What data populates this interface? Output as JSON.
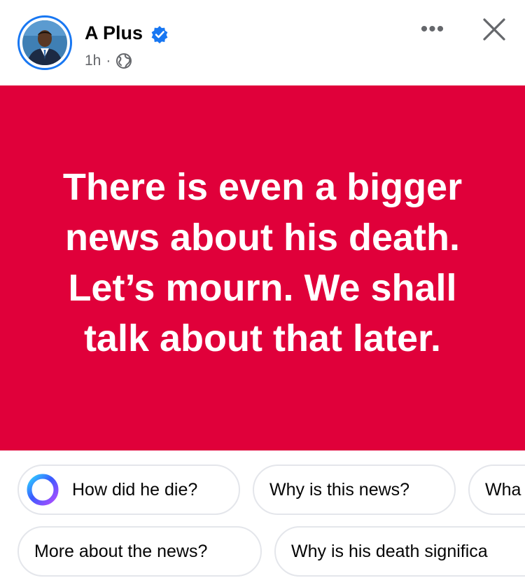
{
  "post": {
    "author_name": "A Plus",
    "verified": true,
    "timestamp": "1h",
    "meta_separator": "·",
    "audience_icon": "globe-icon",
    "more_label": "•••",
    "text": "There is even a bigger news about his death. Let’s mourn. We shall talk about that later.",
    "background_color": "#e0003a"
  },
  "suggestions": {
    "row1": [
      {
        "label": "How did he die?",
        "icon": "meta-ai-icon"
      },
      {
        "label": "Why is this news?"
      },
      {
        "label": "Wha"
      }
    ],
    "row2": [
      {
        "label": "More about the news?"
      },
      {
        "label": "Why is his death significa"
      }
    ]
  },
  "colors": {
    "accent": "#1877f2",
    "banner": "#e0003a",
    "secondary_text": "#65676b"
  }
}
